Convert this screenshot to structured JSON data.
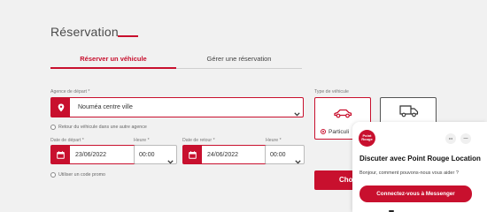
{
  "page": {
    "title": "Réservation"
  },
  "tabs": [
    {
      "label": "Réserver un véhicule",
      "active": true
    },
    {
      "label": "Gérer une réservation",
      "active": false
    }
  ],
  "pickup": {
    "label": "Agence de départ *",
    "value": "Nouméa centre ville",
    "icon": "location-pin-icon",
    "return_other_label": "Retour du véhicule dans une autre agence"
  },
  "departure": {
    "date_label": "Date de départ *",
    "date_value": "23/06/2022",
    "time_label": "Heure *",
    "time_value": "00:00"
  },
  "return": {
    "date_label": "Date de retour *",
    "date_value": "24/06/2022",
    "time_label": "Heure *",
    "time_value": "00:00"
  },
  "promo_label": "Utiliser un code promo",
  "vehicle_type": {
    "label": "Type de véhicule",
    "options": [
      {
        "label": "Particuli",
        "icon": "car-icon",
        "selected": true
      },
      {
        "label": "",
        "icon": "van-icon",
        "selected": false
      }
    ]
  },
  "choose_button": {
    "label": "Cho"
  },
  "chat": {
    "logo_text": [
      "Point",
      "Rouge"
    ],
    "menu_label": "•••",
    "close_label": "—",
    "title": "Discuter avec Point Rouge Location",
    "subtitle": "Bonjour, comment pouvons-nous vous aider ?",
    "button_label": "Connectez-vous à Messenger"
  },
  "colors": {
    "accent": "#c8102e",
    "background": "#f1f1f1"
  }
}
